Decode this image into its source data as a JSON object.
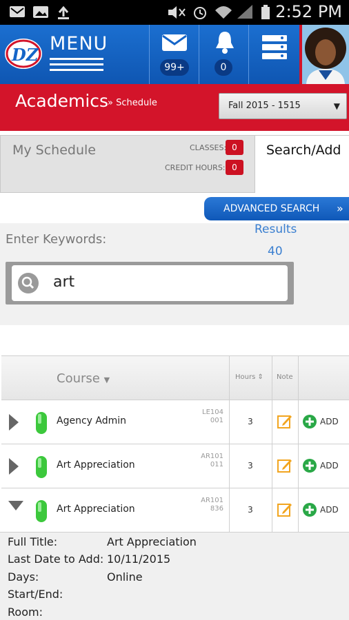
{
  "status_bar": {
    "time": "2:52 PM",
    "left_icons": [
      "sms-icon",
      "image-icon",
      "upload-icon"
    ],
    "right_icons": [
      "mute-icon",
      "alarm-icon",
      "wifi-icon",
      "signal-icon",
      "battery-icon"
    ]
  },
  "nav": {
    "menu_label": "MENU",
    "logo_text": "DZ",
    "mail_badge": "99+",
    "notifications_badge": "0"
  },
  "header": {
    "title": "Academics",
    "breadcrumb": "» Schedule",
    "term": "Fall 2015 - 1515"
  },
  "tabs": {
    "my_schedule": "My Schedule",
    "classes_label": "CLASSES:",
    "classes_count": "0",
    "credit_label": "CREDIT HOURS:",
    "credit_count": "0",
    "search_add": "Search/Add"
  },
  "search": {
    "advanced_label": "ADVANCED SEARCH",
    "keywords_label": "Enter Keywords:",
    "results_label": "Results",
    "results_count": "40",
    "query": "art"
  },
  "table": {
    "col_course": "Course",
    "col_hours": "Hours",
    "col_note": "Note",
    "add_label": "ADD",
    "rows": [
      {
        "name": "Agency Admin",
        "code": "LE104",
        "section": "001",
        "hours": "3",
        "expanded": false
      },
      {
        "name": "Art Appreciation",
        "code": "AR101",
        "section": "011",
        "hours": "3",
        "expanded": false
      },
      {
        "name": "Art Appreciation",
        "code": "AR101",
        "section": "836",
        "hours": "3",
        "expanded": true
      }
    ]
  },
  "details": {
    "full_title_label": "Full Title:",
    "full_title": "Art Appreciation",
    "last_date_label": "Last Date to Add:",
    "last_date": "10/11/2015",
    "days_label": "Days:",
    "days": "Online",
    "start_end_label": "Start/End:",
    "start_end": "",
    "room_label": "Room:",
    "room": ""
  },
  "colors": {
    "brand_blue": "#1565c8",
    "header_red": "#d3142a",
    "status_green": "#3cc83c",
    "add_green": "#2aa847"
  }
}
